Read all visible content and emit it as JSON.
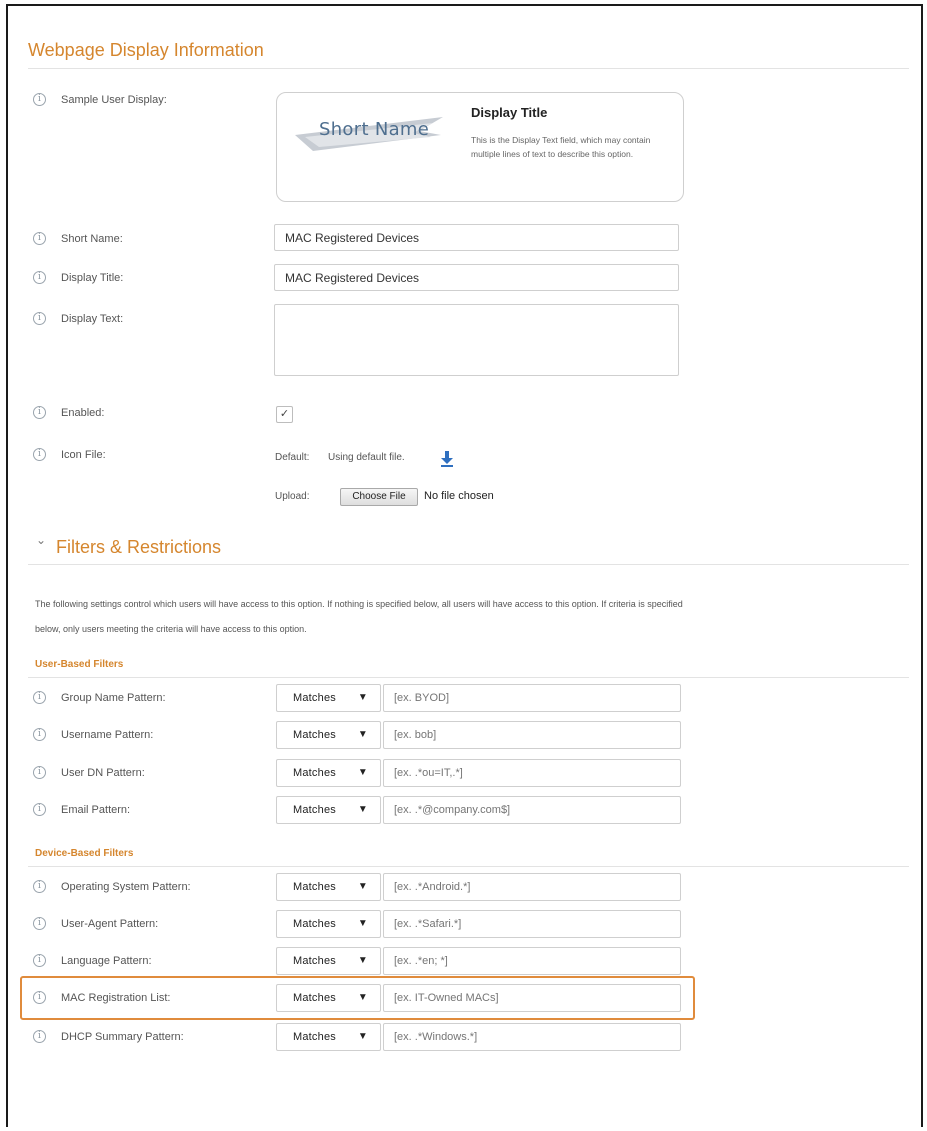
{
  "webpage_display": {
    "section_title": "Webpage Display Information",
    "sample_user_display": {
      "label": "Sample User Display:",
      "banner_text": "Short Name",
      "title": "Display Title",
      "text": "This is the Display Text field, which may contain multiple lines of text to describe this option."
    },
    "short_name": {
      "label": "Short Name:",
      "value": "MAC Registered Devices"
    },
    "display_title": {
      "label": "Display Title:",
      "value": "MAC Registered Devices"
    },
    "display_text": {
      "label": "Display Text:",
      "value": ""
    },
    "enabled": {
      "label": "Enabled:",
      "checked": true,
      "check_glyph": "✓"
    },
    "icon_file": {
      "label": "Icon File:",
      "default_label": "Default:",
      "default_value": "Using default file.",
      "upload_label": "Upload:",
      "choose_button": "Choose File",
      "no_file_text": "No file chosen"
    }
  },
  "filters": {
    "section_title": "Filters & Restrictions",
    "description_line1": "The following settings control which users will have access to this option. If nothing is specified below, all users will have access to this option. If criteria is specified",
    "description_line2": "below, only users meeting the criteria will have access to this option.",
    "user_based": {
      "heading": "User-Based Filters",
      "rows": [
        {
          "label": "Group Name Pattern:",
          "operator": "Matches",
          "placeholder": "[ex. BYOD]"
        },
        {
          "label": "Username Pattern:",
          "operator": "Matches",
          "placeholder": "[ex. bob]"
        },
        {
          "label": "User DN Pattern:",
          "operator": "Matches",
          "placeholder": "[ex. .*ou=IT,.*]"
        },
        {
          "label": "Email Pattern:",
          "operator": "Matches",
          "placeholder": "[ex. .*@company.com$]"
        }
      ]
    },
    "device_based": {
      "heading": "Device-Based Filters",
      "rows": [
        {
          "label": "Operating System Pattern:",
          "operator": "Matches",
          "placeholder": "[ex. .*Android.*]"
        },
        {
          "label": "User-Agent Pattern:",
          "operator": "Matches",
          "placeholder": "[ex. .*Safari.*]"
        },
        {
          "label": "Language Pattern:",
          "operator": "Matches",
          "placeholder": "[ex. .*en; *]"
        },
        {
          "label": "MAC Registration List:",
          "operator": "Matches",
          "placeholder": "[ex. IT-Owned MACs]"
        },
        {
          "label": "DHCP Summary Pattern:",
          "operator": "Matches",
          "placeholder": "[ex. .*Windows.*]"
        }
      ]
    }
  },
  "icons": {
    "info": "info-icon",
    "download": "download-icon",
    "collapse": "chevron-down-icon",
    "dropdown": "caret-down-icon"
  },
  "colors": {
    "accent": "#d5862e",
    "highlight_border": "#e08b3c"
  }
}
